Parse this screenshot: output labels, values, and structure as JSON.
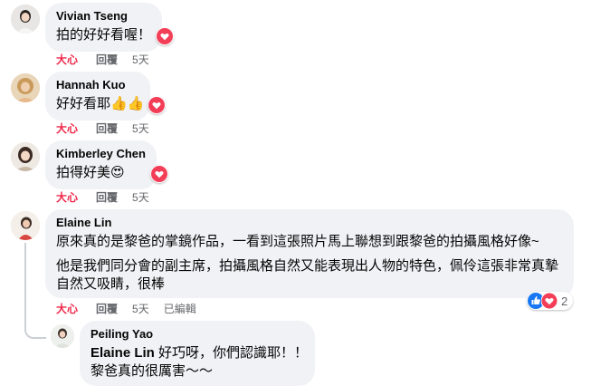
{
  "colors": {
    "bubble": "#f0f2f5",
    "love_action": "#f02849",
    "secondary_text": "#65676b",
    "like_blue": "#1877f2",
    "love_red": "#f33e58"
  },
  "comments": [
    {
      "author": "Vivian Tseng",
      "text": "拍的好好看喔！",
      "reaction_icon": "heart-icon",
      "actions": {
        "love": "大心",
        "reply": "回覆",
        "time": "5天"
      }
    },
    {
      "author": "Hannah Kuo",
      "text": "好好看耶👍👍",
      "reaction_icon": "heart-icon",
      "actions": {
        "love": "大心",
        "reply": "回覆",
        "time": "5天"
      }
    },
    {
      "author": "Kimberley Chen",
      "text": "拍得好美😍",
      "reaction_icon": "heart-icon",
      "actions": {
        "love": "大心",
        "reply": "回覆",
        "time": "5天"
      }
    },
    {
      "author": "Elaine Lin",
      "paragraphs": [
        "原來真的是黎爸的掌鏡作品，一看到這張照片馬上聯想到跟黎爸的拍攝風格好像~",
        "他是我們同分會的副主席，拍攝風格自然又能表現出人物的特色，佩伶這張非常真摯自然又吸睛，很棒"
      ],
      "reactions": {
        "icons": [
          "like-icon",
          "heart-icon"
        ],
        "count": "2"
      },
      "actions": {
        "love": "大心",
        "reply": "回覆",
        "time": "5天",
        "edited": "已編輯"
      }
    }
  ],
  "reply": {
    "author": "Peiling Yao",
    "mention": "Elaine Lin",
    "line1_rest": " 好巧呀，你們認識耶！！",
    "line2": "黎爸真的很厲害～～"
  }
}
